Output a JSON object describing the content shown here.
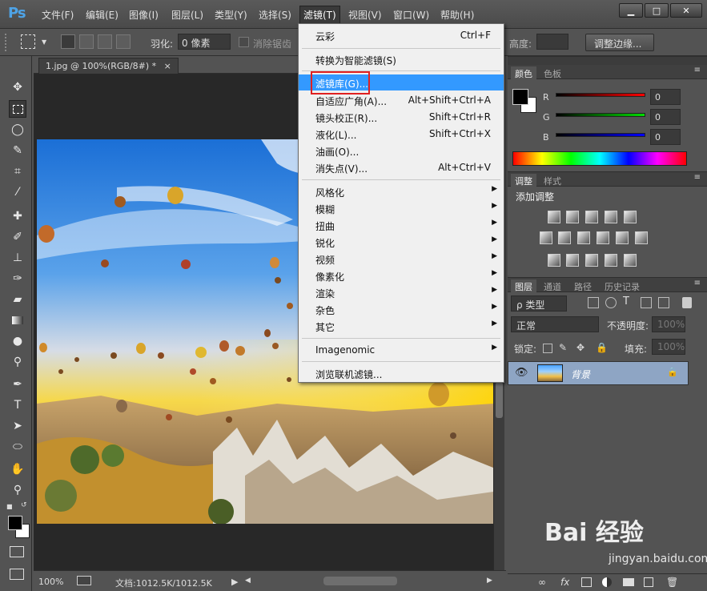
{
  "app": {
    "logo": "Ps"
  },
  "menubar": [
    {
      "label": "文件(F)",
      "name": "menu-file"
    },
    {
      "label": "编辑(E)",
      "name": "menu-edit"
    },
    {
      "label": "图像(I)",
      "name": "menu-image"
    },
    {
      "label": "图层(L)",
      "name": "menu-layer"
    },
    {
      "label": "类型(Y)",
      "name": "menu-type"
    },
    {
      "label": "选择(S)",
      "name": "menu-select"
    },
    {
      "label": "滤镜(T)",
      "name": "menu-filter"
    },
    {
      "label": "视图(V)",
      "name": "menu-view"
    },
    {
      "label": "窗口(W)",
      "name": "menu-window"
    },
    {
      "label": "帮助(H)",
      "name": "menu-help"
    }
  ],
  "window_controls": {
    "minimize": "▁",
    "restore": "□",
    "close": "✕"
  },
  "options": {
    "feather_label": "羽化:",
    "feather_value": "0 像素",
    "antialias_label": "消除锯齿",
    "height_label": "高度:",
    "refine_edge": "调整边缘..."
  },
  "document": {
    "tab_title": "1.jpg @ 100%(RGB/8#) *",
    "close": "×"
  },
  "status": {
    "zoom": "100%",
    "doc_info": "文档:1012.5K/1012.5K"
  },
  "filter_menu": [
    {
      "label": "云彩",
      "shortcut": "Ctrl+F"
    },
    {
      "sep": true
    },
    {
      "label": "转换为智能滤镜(S)"
    },
    {
      "sep": true
    },
    {
      "label": "滤镜库(G)...",
      "highlight": true
    },
    {
      "label": "自适应广角(A)...",
      "shortcut": "Alt+Shift+Ctrl+A"
    },
    {
      "label": "镜头校正(R)...",
      "shortcut": "Shift+Ctrl+R"
    },
    {
      "label": "液化(L)...",
      "shortcut": "Shift+Ctrl+X"
    },
    {
      "label": "油画(O)..."
    },
    {
      "label": "消失点(V)...",
      "shortcut": "Alt+Ctrl+V"
    },
    {
      "sep": true
    },
    {
      "label": "风格化",
      "sub": true
    },
    {
      "label": "模糊",
      "sub": true
    },
    {
      "label": "扭曲",
      "sub": true
    },
    {
      "label": "锐化",
      "sub": true
    },
    {
      "label": "视频",
      "sub": true
    },
    {
      "label": "像素化",
      "sub": true
    },
    {
      "label": "渲染",
      "sub": true
    },
    {
      "label": "杂色",
      "sub": true
    },
    {
      "label": "其它",
      "sub": true
    },
    {
      "sep": true
    },
    {
      "label": "Imagenomic",
      "sub": true
    },
    {
      "sep": true
    },
    {
      "label": "浏览联机滤镜..."
    }
  ],
  "color_panel": {
    "tabs": [
      "颜色",
      "色板"
    ],
    "channels": [
      {
        "label": "R",
        "value": "0",
        "color": "#ff0000"
      },
      {
        "label": "G",
        "value": "0",
        "color": "#00cc00"
      },
      {
        "label": "B",
        "value": "0",
        "color": "#0000ff"
      }
    ]
  },
  "adjust_panel": {
    "tabs": [
      "调整",
      "样式"
    ],
    "title": "添加调整"
  },
  "layers_panel": {
    "tabs": [
      "图层",
      "通道",
      "路径",
      "历史记录"
    ],
    "filter_kind": "ρ 类型",
    "blend_mode": "正常",
    "opacity_label": "不透明度:",
    "opacity_value": "100%",
    "lock_label": "锁定:",
    "fill_label": "填充:",
    "fill_value": "100%",
    "layer_name": "背景"
  },
  "watermark": {
    "brand": "Bai 经验",
    "url": "jingyan.baidu.com"
  }
}
